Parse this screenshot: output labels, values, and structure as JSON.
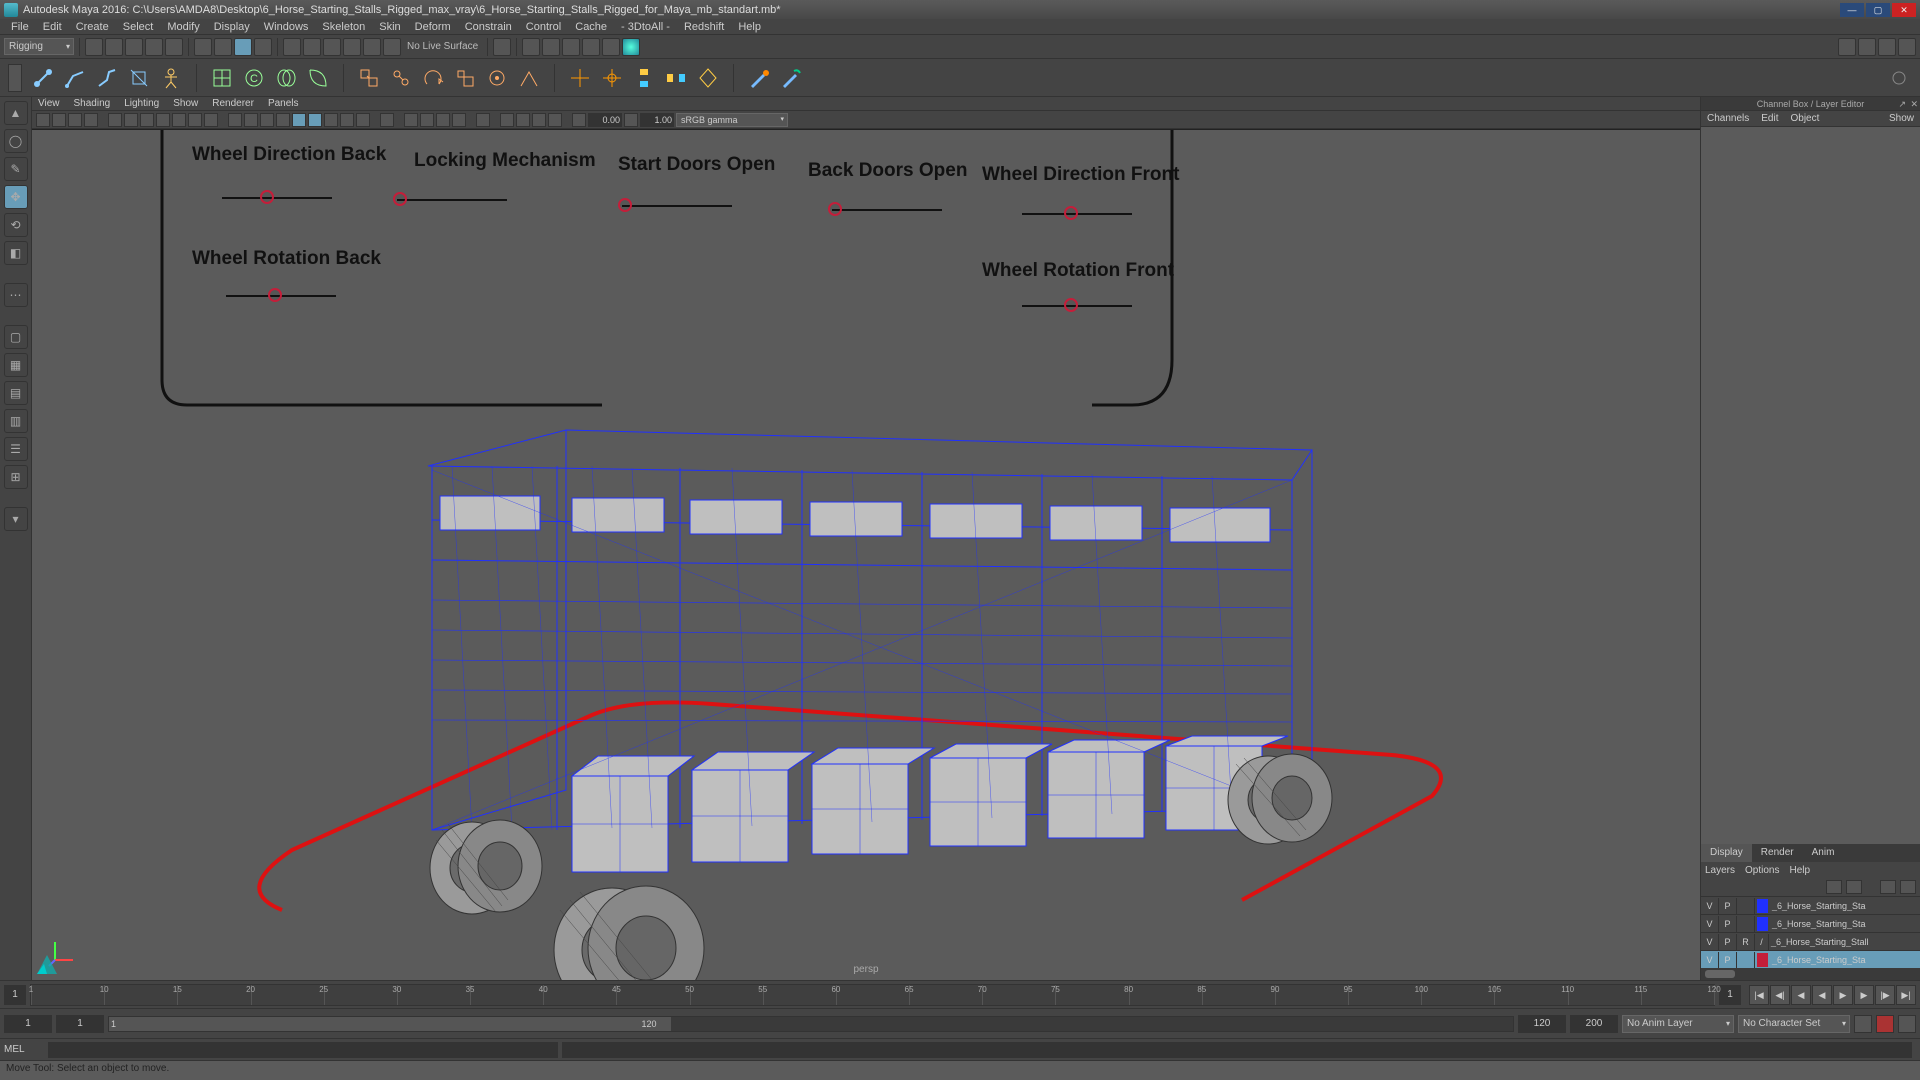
{
  "window": {
    "title": "Autodesk Maya 2016: C:\\Users\\AMDA8\\Desktop\\6_Horse_Starting_Stalls_Rigged_max_vray\\6_Horse_Starting_Stalls_Rigged_for_Maya_mb_standart.mb*"
  },
  "menu": {
    "items": [
      "File",
      "Edit",
      "Create",
      "Select",
      "Modify",
      "Display",
      "Windows",
      "Skeleton",
      "Skin",
      "Deform",
      "Constrain",
      "Control",
      "Cache",
      "- 3DtoAll -",
      "Redshift",
      "Help"
    ]
  },
  "shelf": {
    "mode": "Rigging",
    "no_live_surface": "No Live Surface"
  },
  "viewport_menu": {
    "items": [
      "View",
      "Shading",
      "Lighting",
      "Show",
      "Renderer",
      "Panels"
    ]
  },
  "viewport_toolbar": {
    "val0": "0.00",
    "val1": "1.00",
    "cm": "sRGB gamma"
  },
  "controls": {
    "wheel_dir_back": "Wheel Direction Back",
    "locking": "Locking Mechanism",
    "start_doors": "Start Doors Open",
    "back_doors": "Back Doors Open",
    "wheel_dir_front": "Wheel Direction Front",
    "wheel_rot_back": "Wheel Rotation Back",
    "wheel_rot_front": "Wheel Rotation Front"
  },
  "viewport": {
    "camera": "persp"
  },
  "right_panel": {
    "title": "Channel Box / Layer Editor",
    "top_tabs": [
      "Channels",
      "Edit",
      "Object",
      "Show"
    ],
    "lower_tabs": {
      "display": "Display",
      "render": "Render",
      "anim": "Anim"
    },
    "lower_menu": [
      "Layers",
      "Options",
      "Help"
    ],
    "layers": [
      {
        "v": "V",
        "p": "P",
        "r": "",
        "color": "#2030ff",
        "name": "_6_Horse_Starting_Sta",
        "sel": false
      },
      {
        "v": "V",
        "p": "P",
        "r": "",
        "color": "#2030ff",
        "name": "_6_Horse_Starting_Sta",
        "sel": false
      },
      {
        "v": "V",
        "p": "P",
        "r": "R",
        "color": "#888",
        "name": "_6_Horse_Starting_Stall",
        "sel": false,
        "noswatch": true
      },
      {
        "v": "V",
        "p": "P",
        "r": "",
        "color": "#c41e3a",
        "name": "_6_Horse_Starting_Sta",
        "sel": true
      }
    ]
  },
  "timeline": {
    "cur": "1",
    "cur_end": "1",
    "ticks": [
      "1",
      "10",
      "15",
      "20",
      "25",
      "30",
      "35",
      "40",
      "45",
      "50",
      "55",
      "60",
      "65",
      "70",
      "75",
      "80",
      "85",
      "90",
      "95",
      "100",
      "105",
      "110",
      "115",
      "120"
    ]
  },
  "range": {
    "start": "1",
    "sub_start": "1",
    "sub_label": "1",
    "sub_label_end": "120",
    "end": "120",
    "full_end": "200",
    "anim_layer": "No Anim Layer",
    "char_set": "No Character Set"
  },
  "cmdline": {
    "lang": "MEL"
  },
  "helpline": {
    "text": "Move Tool: Select an object to move."
  }
}
